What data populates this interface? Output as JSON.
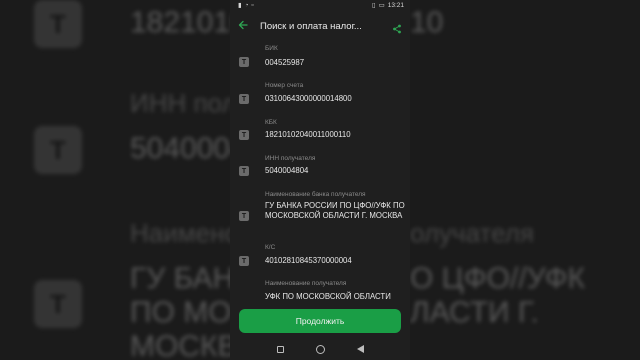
{
  "background": {
    "items": [
      {
        "text": "1821010",
        "suffix": "10"
      },
      {
        "text": "ИНН полу"
      },
      {
        "text": "5040004"
      },
      {
        "text": "Наимено",
        "suffix": "олучателя"
      },
      {
        "text": "ГУ БАНК",
        "suffix": "О ЦФО//УФК"
      },
      {
        "text": "ПО МОС",
        "suffix": "ЛАСТИ Г."
      },
      {
        "text": "МОСКВА"
      }
    ]
  },
  "status_bar": {
    "time": "13:21"
  },
  "app_bar": {
    "title": "Поиск и оплата налог..."
  },
  "fields": [
    {
      "label": "БИК",
      "value": "004525987"
    },
    {
      "label": "Номер счета",
      "value": "03100643000000014800"
    },
    {
      "label": "КБК",
      "value": "18210102040011000110"
    },
    {
      "label": "ИНН получателя",
      "value": "5040004804"
    },
    {
      "label": "Наименование банка получателя",
      "value": "ГУ БАНКА РОССИИ ПО ЦФО//УФК ПО МОСКОВСКОЙ ОБЛАСТИ Г. МОСКВА"
    },
    {
      "label": "К/С",
      "value": "40102810845370000004"
    },
    {
      "label": "Наименование получателя",
      "value": "УФК ПО МОСКОВСКОЙ ОБЛАСТИ"
    }
  ],
  "field_icon_glyph": "T",
  "continue_button": {
    "label": "Продолжить"
  },
  "colors": {
    "accent": "#1a9e46",
    "background": "#1f1f1f"
  }
}
